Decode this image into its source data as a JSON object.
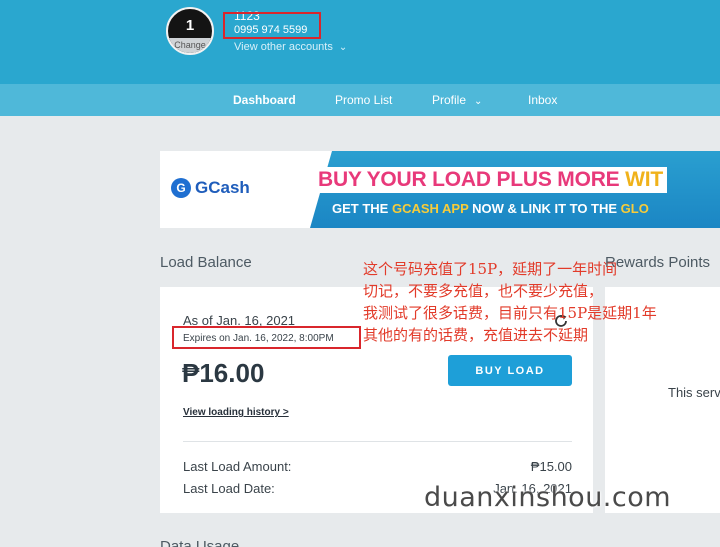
{
  "account": {
    "avatar_initial": "1",
    "avatar_change_label": "Change",
    "name": "1123",
    "number": "0995 974 5599",
    "view_other_accounts": "View other accounts"
  },
  "nav": {
    "items": [
      {
        "label": "Dashboard"
      },
      {
        "label": "Promo List"
      },
      {
        "label": "Profile"
      },
      {
        "label": "Inbox"
      }
    ]
  },
  "banner": {
    "logo_text": "GCash",
    "logo_initial": "G",
    "headline_part1": "BUY YOUR LOAD PLUS MORE ",
    "headline_part2": "WIT",
    "sub_part1": "GET THE ",
    "sub_part2": "GCASH APP",
    "sub_part3": " NOW & LINK IT TO THE ",
    "sub_part4": "GLO"
  },
  "load_balance": {
    "title": "Load Balance",
    "as_of": "As of Jan. 16, 2021",
    "expires": "Expires on Jan. 16, 2022, 8:00PM",
    "balance": "₱16.00",
    "buy_load_label": "BUY LOAD",
    "history_link": "View loading history >",
    "last_load_amount_label": "Last Load Amount:",
    "last_load_amount_value": "₱15.00",
    "last_load_date_label": "Last Load Date:",
    "last_load_date_value": "Jan. 16, 2021"
  },
  "rewards": {
    "title": "Rewards Points",
    "service_text": "This serv"
  },
  "data_usage": {
    "title": "Data Usage"
  },
  "annotation": {
    "lines": [
      "这个号码充值了15P，延期了一年时间",
      "切记，不要多充值，也不要少充值，",
      "我测试了很多话费，目前只有15P是延期1年",
      "其他的有的话费，充值进去不延期"
    ]
  },
  "watermark": "duanxinshou.com",
  "colors": {
    "header": "#2aa7cf",
    "nav": "#4fb8d9",
    "button": "#1e9fd8",
    "highlight_box": "#d9262c",
    "annotation": "#e23b2a"
  }
}
